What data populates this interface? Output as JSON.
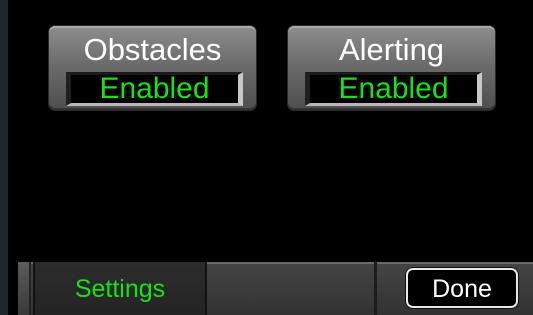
{
  "controls": [
    {
      "title": "Obstacles",
      "value": "Enabled"
    },
    {
      "title": "Alerting",
      "value": "Enabled"
    }
  ],
  "bottom_bar": {
    "tab_label": "Settings",
    "done_label": "Done"
  },
  "colors": {
    "background": "#000000",
    "active_text": "#19e019",
    "button_gray": "#6c6c6c",
    "label_white": "#ffffff"
  }
}
